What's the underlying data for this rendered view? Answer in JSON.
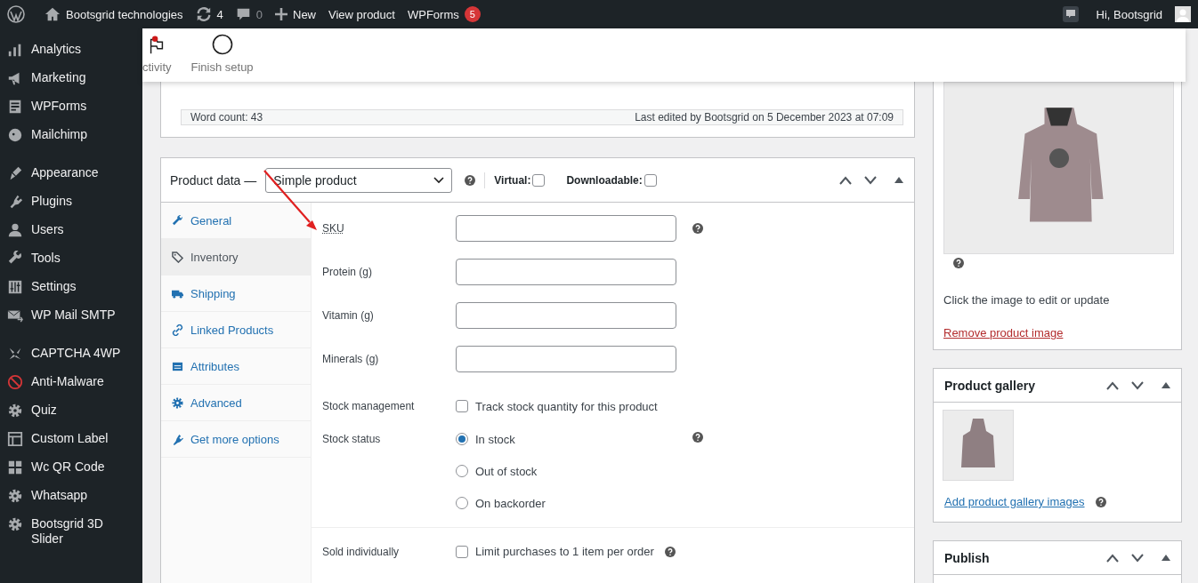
{
  "admin_bar": {
    "site_name": "Bootsgrid technologies",
    "updates": "4",
    "comments": "0",
    "new": "New",
    "view": "View product",
    "wpforms": "WPForms",
    "wpforms_count": "5",
    "greeting": "Hi, Bootsgrid"
  },
  "sidebar": {
    "groups": [
      [
        {
          "label": "Analytics",
          "kind": "chart"
        },
        {
          "label": "Marketing",
          "kind": "megaphone"
        },
        {
          "label": "WPForms",
          "kind": "form"
        },
        {
          "label": "Mailchimp",
          "kind": "monkey"
        }
      ],
      [
        {
          "label": "Appearance",
          "kind": "brush"
        },
        {
          "label": "Plugins",
          "kind": "plug"
        },
        {
          "label": "Users",
          "kind": "user"
        },
        {
          "label": "Tools",
          "kind": "wrench"
        },
        {
          "label": "Settings",
          "kind": "sliders"
        },
        {
          "label": "WP Mail SMTP",
          "kind": "mail"
        }
      ],
      [
        {
          "label": "CAPTCHA 4WP",
          "kind": "captcha"
        },
        {
          "label": "Anti-Malware",
          "kind": "shield"
        },
        {
          "label": "Quiz",
          "kind": "gear"
        },
        {
          "label": "Custom Label",
          "kind": "layout"
        },
        {
          "label": "Wc QR Code",
          "kind": "grid"
        },
        {
          "label": "Whatsapp",
          "kind": "gear"
        },
        {
          "label": "Bootsgrid 3D Slider",
          "kind": "gear"
        }
      ]
    ]
  },
  "activity_bar": {
    "items": [
      {
        "label": "ctivity",
        "kind": "flag",
        "unread": true
      },
      {
        "label": "Finish setup",
        "kind": "progress",
        "unread": false
      }
    ]
  },
  "editor_status": {
    "word_count": "Word count: 43",
    "last_edited": "Last edited by Bootsgrid on 5 December 2023 at 07:09"
  },
  "product_data": {
    "title": "Product data —",
    "type": "Simple product",
    "help": true,
    "virtual": {
      "label": "Virtual:",
      "checked": false
    },
    "downloadable": {
      "label": "Downloadable:",
      "checked": false
    },
    "tabs": [
      {
        "label": "General",
        "kind": "wrench",
        "selected": false
      },
      {
        "label": "Inventory",
        "kind": "tag",
        "selected": true
      },
      {
        "label": "Shipping",
        "kind": "truck",
        "selected": false
      },
      {
        "label": "Linked Products",
        "kind": "link",
        "selected": false
      },
      {
        "label": "Attributes",
        "kind": "list",
        "selected": false
      },
      {
        "label": "Advanced",
        "kind": "gear",
        "selected": false
      },
      {
        "label": "Get more options",
        "kind": "plug",
        "selected": false
      }
    ],
    "fields": [
      {
        "kind": "text",
        "label": "SKU",
        "abbr": true,
        "help": true
      },
      {
        "kind": "text",
        "label": "Protein (g)",
        "abbr": false,
        "help": false
      },
      {
        "kind": "text",
        "label": "Vitamin (g)",
        "abbr": false,
        "help": false
      },
      {
        "kind": "text",
        "label": "Minerals (g)",
        "abbr": false,
        "help": false
      },
      {
        "kind": "checkbox",
        "label": "Stock management",
        "text": "Track stock quantity for this product",
        "checked": false,
        "help": false
      },
      {
        "kind": "radio",
        "label": "Stock status",
        "help": true,
        "options": [
          {
            "label": "In stock",
            "selected": true
          },
          {
            "label": "Out of stock",
            "selected": false
          },
          {
            "label": "On backorder",
            "selected": false
          }
        ]
      },
      {
        "kind": "checkbox",
        "label": "Sold individually",
        "text": "Limit purchases to 1 item per order",
        "checked": false,
        "help": true,
        "divider": true
      }
    ]
  },
  "product_image": {
    "help": true,
    "caption": "Click the image to edit or update",
    "remove_link": "Remove product image"
  },
  "product_gallery": {
    "title": "Product gallery",
    "add_link": "Add product gallery images",
    "help": true
  },
  "publish": {
    "title": "Publish"
  }
}
